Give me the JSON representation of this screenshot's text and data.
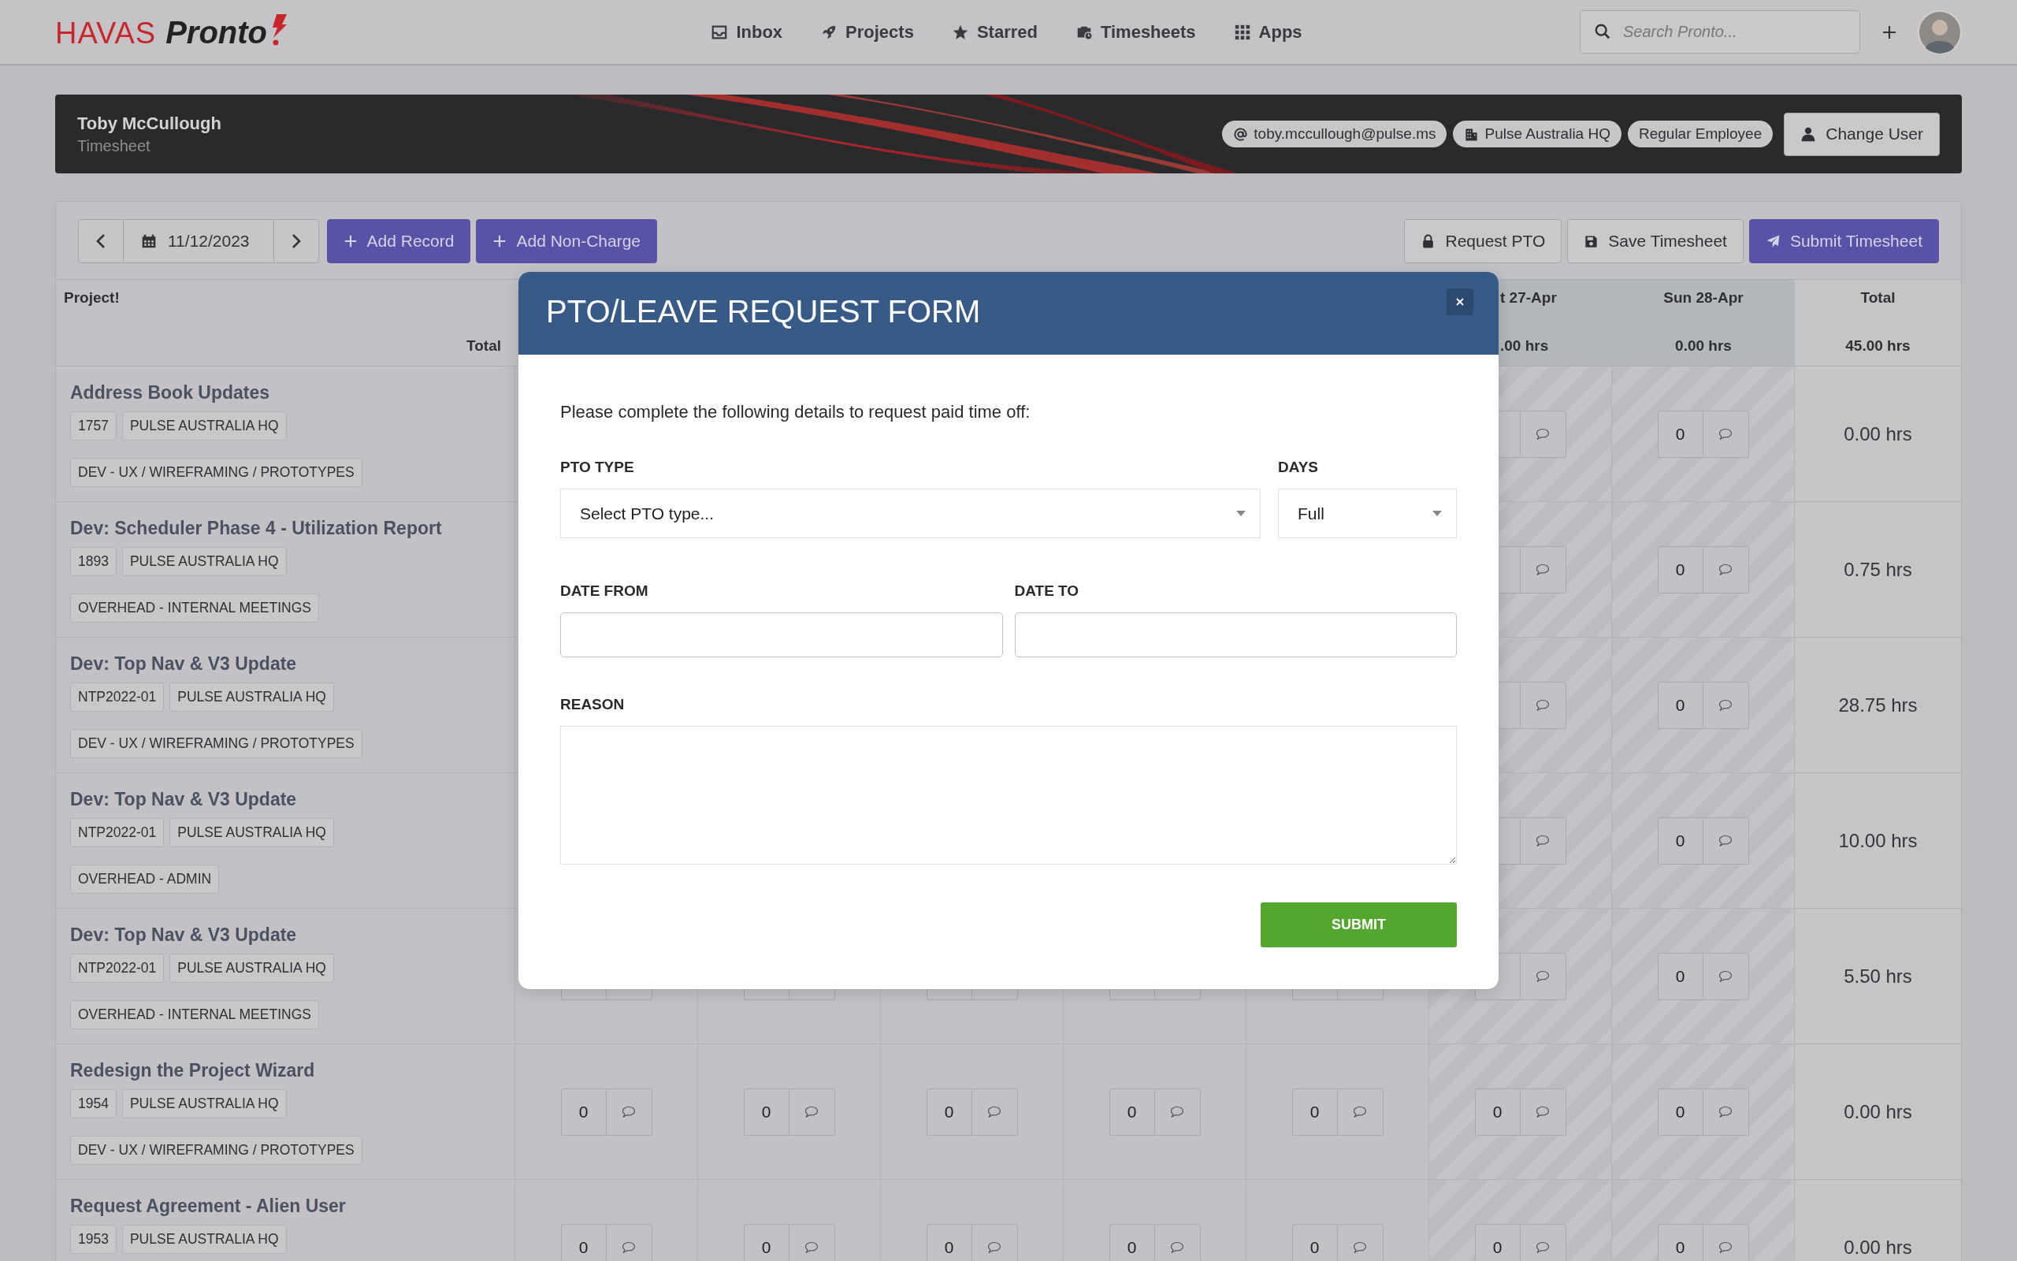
{
  "nav": {
    "logo": {
      "brand": "HAVAS",
      "product": "Pronto"
    },
    "items": [
      {
        "kind": "inbox",
        "label": "Inbox"
      },
      {
        "kind": "projects",
        "label": "Projects"
      },
      {
        "kind": "starred",
        "label": "Starred"
      },
      {
        "kind": "timesheets",
        "label": "Timesheets"
      },
      {
        "kind": "apps",
        "label": "Apps"
      }
    ],
    "search": {
      "placeholder": "Search Pronto..."
    }
  },
  "user_banner": {
    "name": "Toby McCullough",
    "subtitle": "Timesheet",
    "chips": [
      {
        "kind": "email",
        "label": "toby.mccullough@pulse.ms"
      },
      {
        "kind": "office",
        "label": "Pulse Australia HQ"
      },
      {
        "kind": "role",
        "label": "Regular Employee"
      }
    ],
    "button": "Change User"
  },
  "toolbar": {
    "date": "11/12/2023",
    "left_buttons": [
      "Add Record",
      "Add Non-Charge"
    ],
    "right_buttons": [
      {
        "kind": "pto",
        "label": "Request PTO"
      },
      {
        "kind": "save",
        "label": "Save Timesheet"
      },
      {
        "kind": "submit",
        "label": "Submit Timesheet"
      }
    ]
  },
  "table": {
    "project_header": "Project!",
    "total_label": "Total",
    "day_columns": [
      {
        "label": "t 27-Apr",
        "total": ".00 hrs",
        "weekend": true
      },
      {
        "label": "Sun 28-Apr",
        "total": "0.00 hrs",
        "weekend": true
      }
    ],
    "total_column": {
      "label": "Total",
      "total": "45.00 hrs"
    },
    "rows": [
      {
        "project": "Address Book Updates",
        "code": "1757",
        "office": "PULSE AUSTRALIA HQ",
        "task": "DEV - UX / WIREFRAMING / PROTOTYPES",
        "hours": [
          {
            "kind": "blank"
          },
          {
            "kind": "entry",
            "value": "0"
          }
        ],
        "total": "0.00 hrs"
      },
      {
        "project": "Dev: Scheduler Phase 4 - Utilization Report",
        "code": "1893",
        "office": "PULSE AUSTRALIA HQ",
        "task": "OVERHEAD - INTERNAL MEETINGS",
        "hours": [
          {
            "kind": "blank"
          },
          {
            "kind": "entry",
            "value": "0"
          }
        ],
        "total": "0.75 hrs"
      },
      {
        "project": "Dev: Top Nav & V3 Update",
        "code": "NTP2022-01",
        "office": "PULSE AUSTRALIA HQ",
        "task": "DEV - UX / WIREFRAMING / PROTOTYPES",
        "hours": [
          {
            "kind": "blank"
          },
          {
            "kind": "entry",
            "value": "0"
          }
        ],
        "total": "28.75 hrs"
      },
      {
        "project": "Dev: Top Nav & V3 Update",
        "code": "NTP2022-01",
        "office": "PULSE AUSTRALIA HQ",
        "task": "OVERHEAD - ADMIN",
        "hours": [
          {
            "kind": "blank"
          },
          {
            "kind": "entry",
            "value": "0"
          }
        ],
        "total": "10.00 hrs"
      },
      {
        "project": "Dev: Top Nav & V3 Update",
        "code": "NTP2022-01",
        "office": "PULSE AUSTRALIA HQ",
        "task": "OVERHEAD - INTERNAL MEETINGS",
        "hours": [
          {
            "kind": "sliver"
          },
          {
            "kind": "sliver"
          },
          {
            "kind": "sliver"
          },
          {
            "kind": "sliver"
          },
          {
            "kind": "sliver"
          },
          {
            "kind": "blank"
          },
          {
            "kind": "entry",
            "value": "0"
          }
        ],
        "total": "5.50 hrs"
      },
      {
        "project": "Redesign the Project Wizard",
        "code": "1954",
        "office": "PULSE AUSTRALIA HQ",
        "task": "DEV - UX / WIREFRAMING / PROTOTYPES",
        "hours": [
          {
            "kind": "entry",
            "value": "0"
          },
          {
            "kind": "entry",
            "value": "0"
          },
          {
            "kind": "entry",
            "value": "0"
          },
          {
            "kind": "entry",
            "value": "0"
          },
          {
            "kind": "entry",
            "value": "0"
          },
          {
            "kind": "entry",
            "value": "0"
          },
          {
            "kind": "entry",
            "value": "0"
          }
        ],
        "total": "0.00 hrs"
      },
      {
        "project": "Request Agreement - Alien User",
        "code": "1953",
        "office": "PULSE AUSTRALIA HQ",
        "hours": [
          {
            "kind": "entry",
            "value": "0"
          },
          {
            "kind": "entry",
            "value": "0"
          },
          {
            "kind": "entry",
            "value": "0"
          },
          {
            "kind": "entry",
            "value": "0"
          },
          {
            "kind": "entry",
            "value": "0"
          },
          {
            "kind": "entry",
            "value": "0"
          },
          {
            "kind": "entry",
            "value": "0"
          }
        ],
        "total": "0.00 hrs"
      }
    ]
  },
  "modal": {
    "title": "PTO/LEAVE REQUEST FORM",
    "intro": "Please complete the following details to request paid time off:",
    "field_rows": [
      [
        {
          "kind": "select",
          "label": "PTO TYPE",
          "value": "Select PTO type..."
        },
        {
          "kind": "select",
          "label": "DAYS",
          "value": "Full"
        }
      ],
      [
        {
          "kind": "date",
          "label": "DATE FROM"
        },
        {
          "kind": "date",
          "label": "DATE TO"
        }
      ],
      [
        {
          "kind": "textarea",
          "label": "REASON"
        }
      ]
    ],
    "submit": "SUBMIT"
  }
}
